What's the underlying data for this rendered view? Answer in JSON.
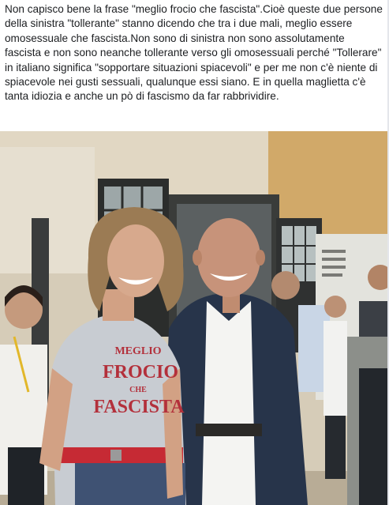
{
  "post": {
    "text": "Non capisco bene la frase \"meglio frocio che fascista\".Cioè queste due persone della sinistra \"tollerante\" stanno dicendo che tra i due mali, meglio essere omosessuale che fascista.Non sono di sinistra non sono assolutamente fascista e non sono neanche tollerante verso gli omosessuali perché \"Tollerare\" in italiano significa \"sopportare situazioni spiacevoli\" e per me non c'è niente di spiacevole nei gusti sessuali, qualunque essi siano. E in quella maglietta c'è tanta idiozia e anche un pò di fascismo da far rabbrividire."
  },
  "photo": {
    "shirt_lines": [
      "MEGLIO",
      "FROCIO",
      "CHE",
      "FASCISTA"
    ],
    "colors": {
      "wall": "#d8cdb6",
      "shirt": "#c8ccd2",
      "shirt_print": "#b3303b",
      "belt": "#c62a34",
      "jacket": "#27344a",
      "white_shirt": "#f4f4f2"
    }
  }
}
